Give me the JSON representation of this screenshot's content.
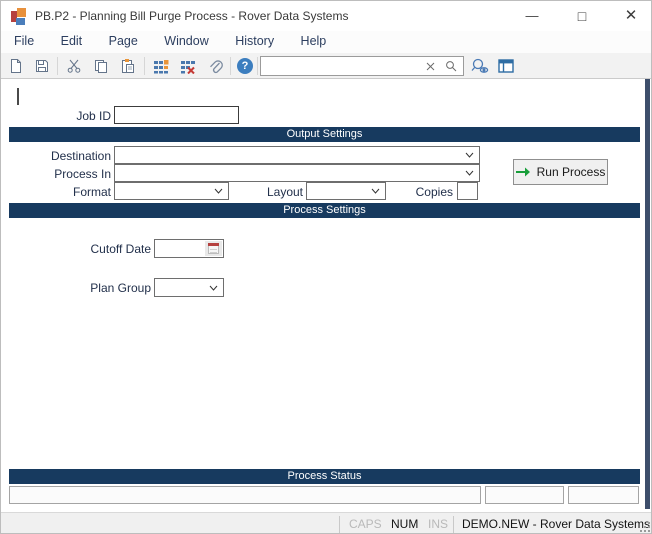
{
  "window": {
    "title": "PB.P2 - Planning Bill Purge Process - Rover Data Systems",
    "minimize_glyph": "—",
    "maximize_glyph": "□",
    "close_glyph": "✕"
  },
  "menu": {
    "items": [
      "File",
      "Edit",
      "Page",
      "Window",
      "History",
      "Help"
    ]
  },
  "toolbar": {
    "icons": [
      "new-document",
      "save",
      "cut",
      "copy",
      "paste",
      "insert-rows",
      "delete-rows",
      "attachment",
      "help",
      "search-clear",
      "search-magnifier",
      "advanced-find",
      "layout-view"
    ],
    "help_glyph": "?",
    "search": {
      "value": ""
    }
  },
  "form": {
    "job_id": {
      "label": "Job ID",
      "value": ""
    },
    "output_section": {
      "title": "Output Settings"
    },
    "destination": {
      "label": "Destination",
      "value": ""
    },
    "process_in": {
      "label": "Process In",
      "value": ""
    },
    "run_process": {
      "label": "Run Process"
    },
    "format": {
      "label": "Format",
      "value": ""
    },
    "layout": {
      "label": "Layout",
      "value": ""
    },
    "copies": {
      "label": "Copies",
      "value": ""
    },
    "process_section": {
      "title": "Process Settings"
    },
    "cutoff_date": {
      "label": "Cutoff Date",
      "value": ""
    },
    "plan_group": {
      "label": "Plan Group",
      "value": ""
    },
    "status_section": {
      "title": "Process Status"
    },
    "status_fields": [
      "",
      "",
      ""
    ]
  },
  "statusbar": {
    "caps": "CAPS",
    "num": "NUM",
    "ins": "INS",
    "context": "DEMO.NEW - Rover Data Systems"
  },
  "colors": {
    "section_header": "#173a5f",
    "edge_strip": "#3d4e6b",
    "help_blue": "#3c7ebf",
    "icon_gray": "#64748a",
    "icon_blue": "#4a78ad",
    "icon_orange": "#e8953a",
    "icon_red": "#c43a36",
    "run_arrow_green": "#189e3a",
    "logo_red": "#b5413f",
    "logo_orange": "#e8913d",
    "logo_blue": "#4a7ebb"
  }
}
